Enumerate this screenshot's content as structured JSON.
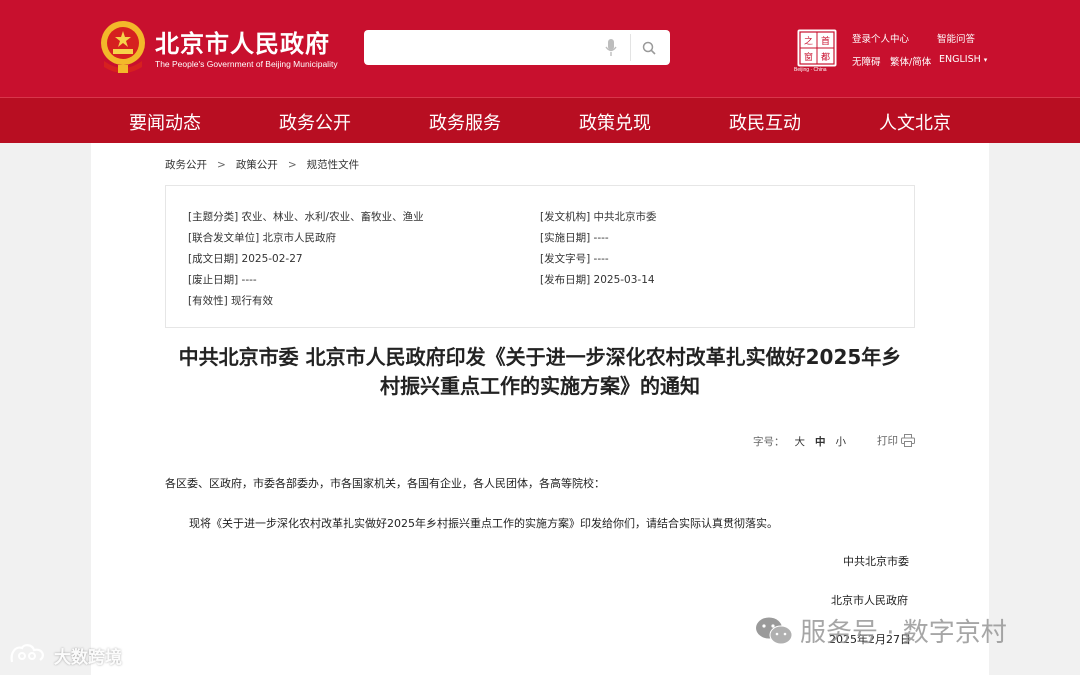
{
  "header": {
    "site_title": "北京市人民政府",
    "site_subtitle": "The People's Government of Beijing Municipality",
    "search_placeholder": "",
    "seal_caption": "Beijing · China",
    "seal_text": "首都之窗",
    "links": {
      "login": "登录个人中心",
      "smart_qa": "智能问答",
      "accessibility": "无障碍",
      "traditional": "繁体/简体",
      "english": "ENGLISH",
      "english_caret": "▾"
    },
    "brand_color": "#c8102e",
    "nav_color": "#b80e22"
  },
  "nav": {
    "items": [
      "要闻动态",
      "政务公开",
      "政务服务",
      "政策兑现",
      "政民互动",
      "人文北京"
    ]
  },
  "breadcrumb": {
    "items": [
      "政务公开",
      "政策公开",
      "规范性文件"
    ],
    "separator": ">"
  },
  "meta": {
    "topic": "[主题分类] 农业、林业、水利/农业、畜牧业、渔业",
    "issuer": "[发文机构] 中共北京市委",
    "joint_issuer": "[联合发文单位] 北京市人民政府",
    "effective_date": "[实施日期] ----",
    "written_date": "[成文日期] 2025-02-27",
    "doc_number": "[发文字号] ----",
    "repeal_date": "[废止日期] ----",
    "publish_date": "[发布日期] 2025-03-14",
    "validity": "[有效性] 现行有效"
  },
  "document": {
    "title_line1": "中共北京市委 北京市人民政府印发《关于进一步深化农村改革扎实做好2025年乡",
    "title_line2": "村振兴重点工作的实施方案》的通知",
    "font_size_label": "字号：",
    "font_sizes": [
      "大",
      "中",
      "小"
    ],
    "print_label": "打印",
    "salutation": "各区委、区政府，市委各部委办，市各国家机关，各国有企业，各人民团体，各高等院校：",
    "body": "现将《关于进一步深化农村改革扎实做好2025年乡村振兴重点工作的实施方案》印发给你们，请结合实际认真贯彻落实。",
    "signer1": "中共北京市委",
    "signer2": "北京市人民政府",
    "date": "2025年2月27日"
  },
  "watermarks": {
    "left": "大数跨境",
    "right": "服务号 · 数字京村"
  }
}
